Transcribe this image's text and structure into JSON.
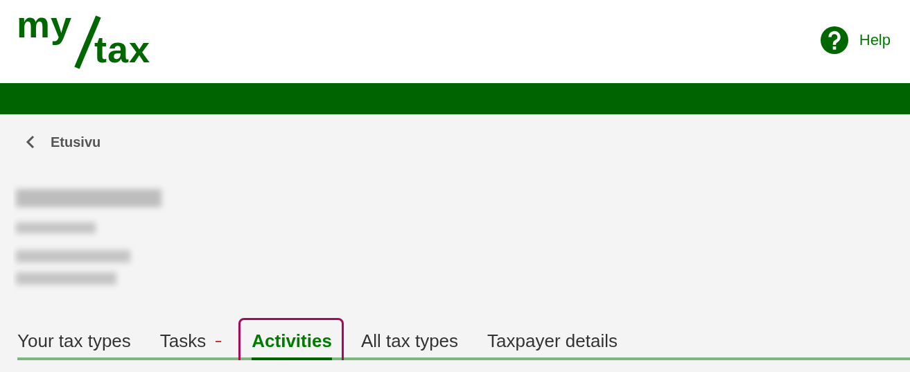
{
  "logo": {
    "top": "my",
    "bottom": "tax"
  },
  "help": {
    "label": "Help"
  },
  "breadcrumb": {
    "label": "Etusivu"
  },
  "tabs": [
    {
      "label": "Your tax types",
      "selected": false,
      "highlighted": false,
      "badge": false
    },
    {
      "label": "Tasks",
      "selected": false,
      "highlighted": false,
      "badge": true
    },
    {
      "label": "Activities",
      "selected": true,
      "highlighted": true,
      "badge": false
    },
    {
      "label": "All tax types",
      "selected": false,
      "highlighted": false,
      "badge": false
    },
    {
      "label": "Taxpayer details",
      "selected": false,
      "highlighted": false,
      "badge": false
    }
  ]
}
